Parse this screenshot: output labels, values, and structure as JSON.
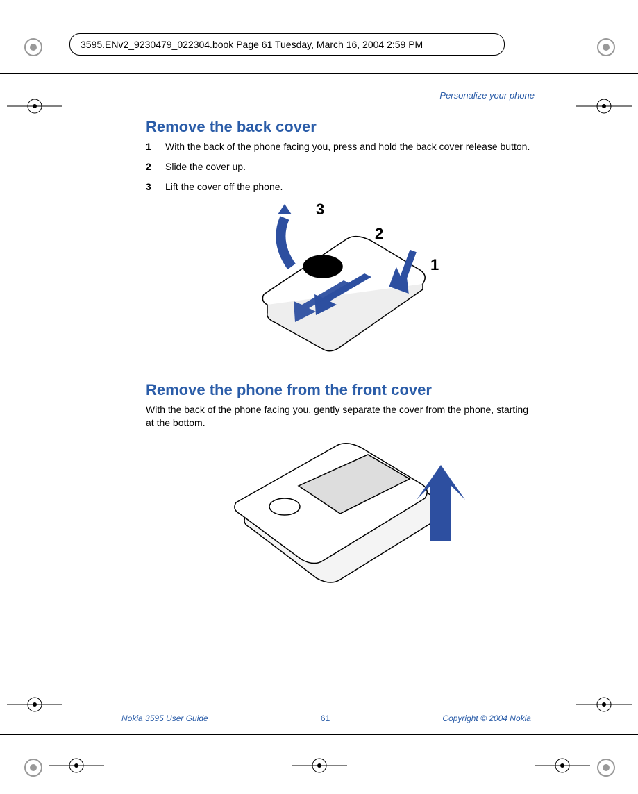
{
  "crop_header": "3595.ENv2_9230479_022304.book  Page 61  Tuesday, March 16, 2004  2:59 PM",
  "running_head": "Personalize your phone",
  "section1": {
    "title": "Remove the back cover",
    "steps": [
      {
        "num": "1",
        "text": "With the back of the phone facing you, press and hold the back cover release button."
      },
      {
        "num": "2",
        "text": "Slide the cover up."
      },
      {
        "num": "3",
        "text": "Lift the cover off the phone."
      }
    ],
    "callouts": {
      "c1": "1",
      "c2": "2",
      "c3": "3"
    }
  },
  "section2": {
    "title": "Remove the phone from the front cover",
    "body": "With the back of the phone facing you, gently separate the cover from the phone, starting at the bottom."
  },
  "footer": {
    "left": "Nokia 3595 User Guide",
    "page": "61",
    "right": "Copyright © 2004 Nokia"
  }
}
